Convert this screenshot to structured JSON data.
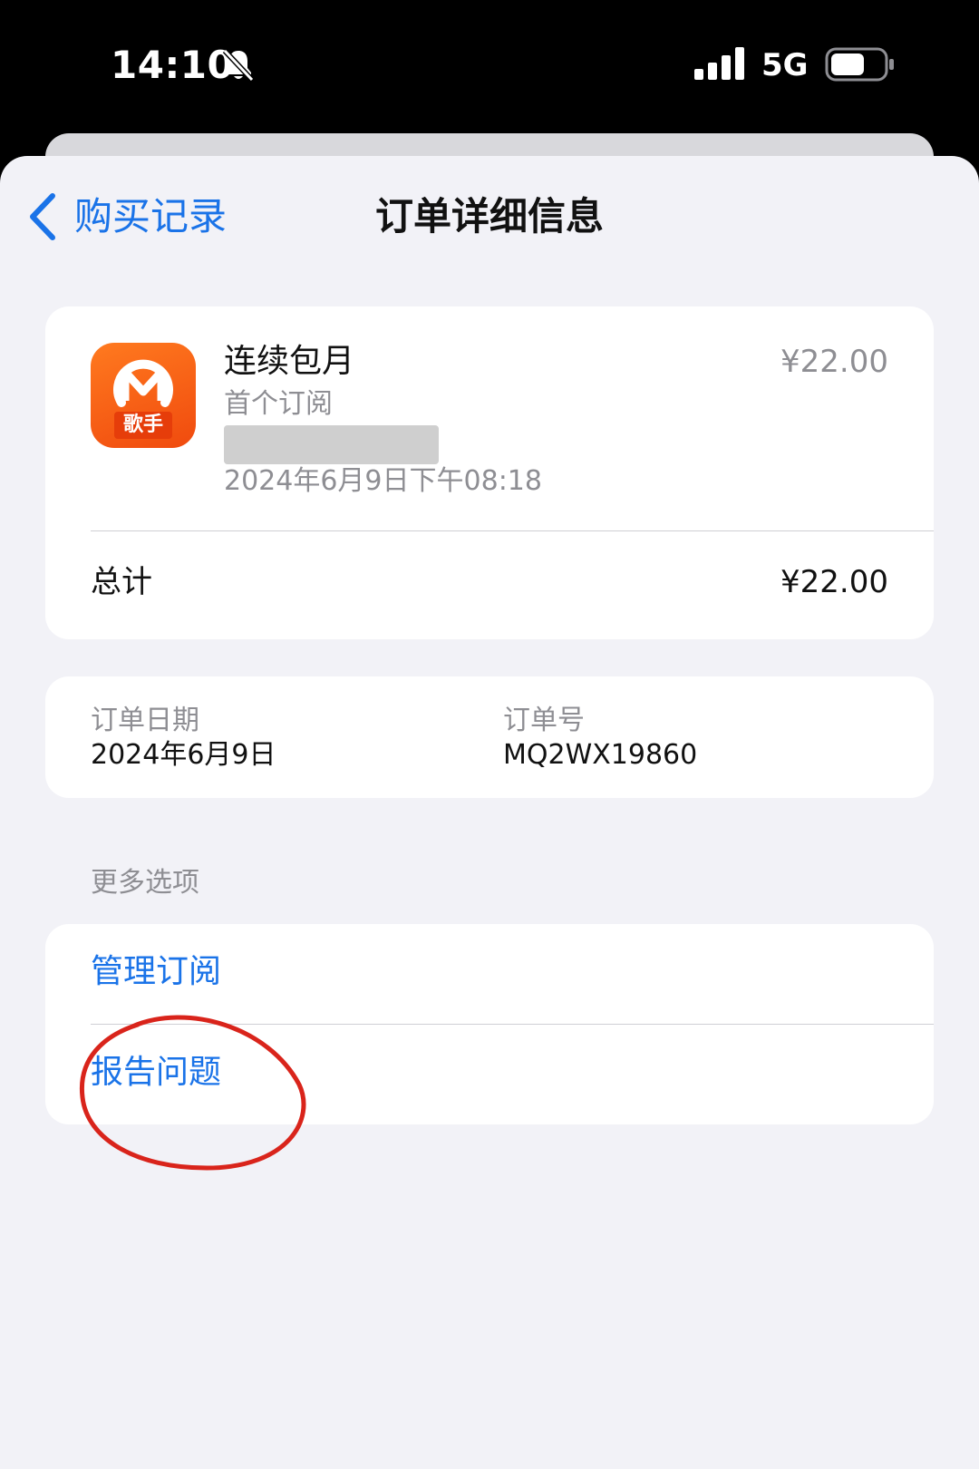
{
  "status_bar": {
    "time": "14:10",
    "network": "5G"
  },
  "nav": {
    "back_label": "购买记录",
    "title": "订单详细信息"
  },
  "order_item": {
    "app_icon_label": "歌手",
    "title": "连续包月",
    "price": "¥22.00",
    "subtitle": "首个订阅",
    "datetime": "2024年6月9日下午08:18"
  },
  "total": {
    "label": "总计",
    "value": "¥22.00"
  },
  "order_info": {
    "date_label": "订单日期",
    "date_value": "2024年6月9日",
    "number_label": "订单号",
    "number_value": "MQ2WX19860"
  },
  "more_options": {
    "header": "更多选项",
    "items": [
      {
        "label": "管理订阅"
      },
      {
        "label": "报告问题"
      }
    ]
  },
  "colors": {
    "link_blue": "#1a73e8",
    "app_icon_orange": "#f04a0e",
    "annotation_red": "#d9241b",
    "sheet_bg": "#f2f2f7"
  }
}
